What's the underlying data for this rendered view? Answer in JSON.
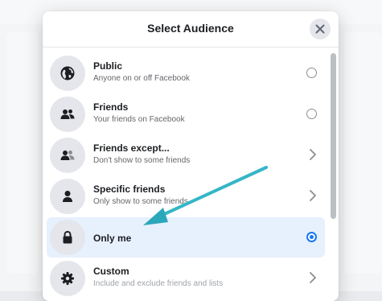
{
  "dialog": {
    "title": "Select Audience",
    "close_icon": "close-icon",
    "options": [
      {
        "label": "Public",
        "description": "Anyone on or off Facebook",
        "icon": "globe-icon",
        "control": "radio",
        "selected": false
      },
      {
        "label": "Friends",
        "description": "Your friends on Facebook",
        "icon": "friends-icon",
        "control": "radio",
        "selected": false
      },
      {
        "label": "Friends except...",
        "description": "Don't show to some friends",
        "icon": "friends-except-icon",
        "control": "chevron",
        "selected": false
      },
      {
        "label": "Specific friends",
        "description": "Only show to some friends",
        "icon": "person-icon",
        "control": "chevron",
        "selected": false
      },
      {
        "label": "Only me",
        "description": "",
        "icon": "lock-icon",
        "control": "radio",
        "selected": true
      },
      {
        "label": "Custom",
        "description": "Include and exclude friends and lists",
        "icon": "gear-icon",
        "control": "chevron",
        "selected": false
      }
    ]
  },
  "colors": {
    "accent": "#1877f2",
    "selected_bg": "#e7f0fd",
    "annotation_arrow": "#2bb5c5"
  }
}
